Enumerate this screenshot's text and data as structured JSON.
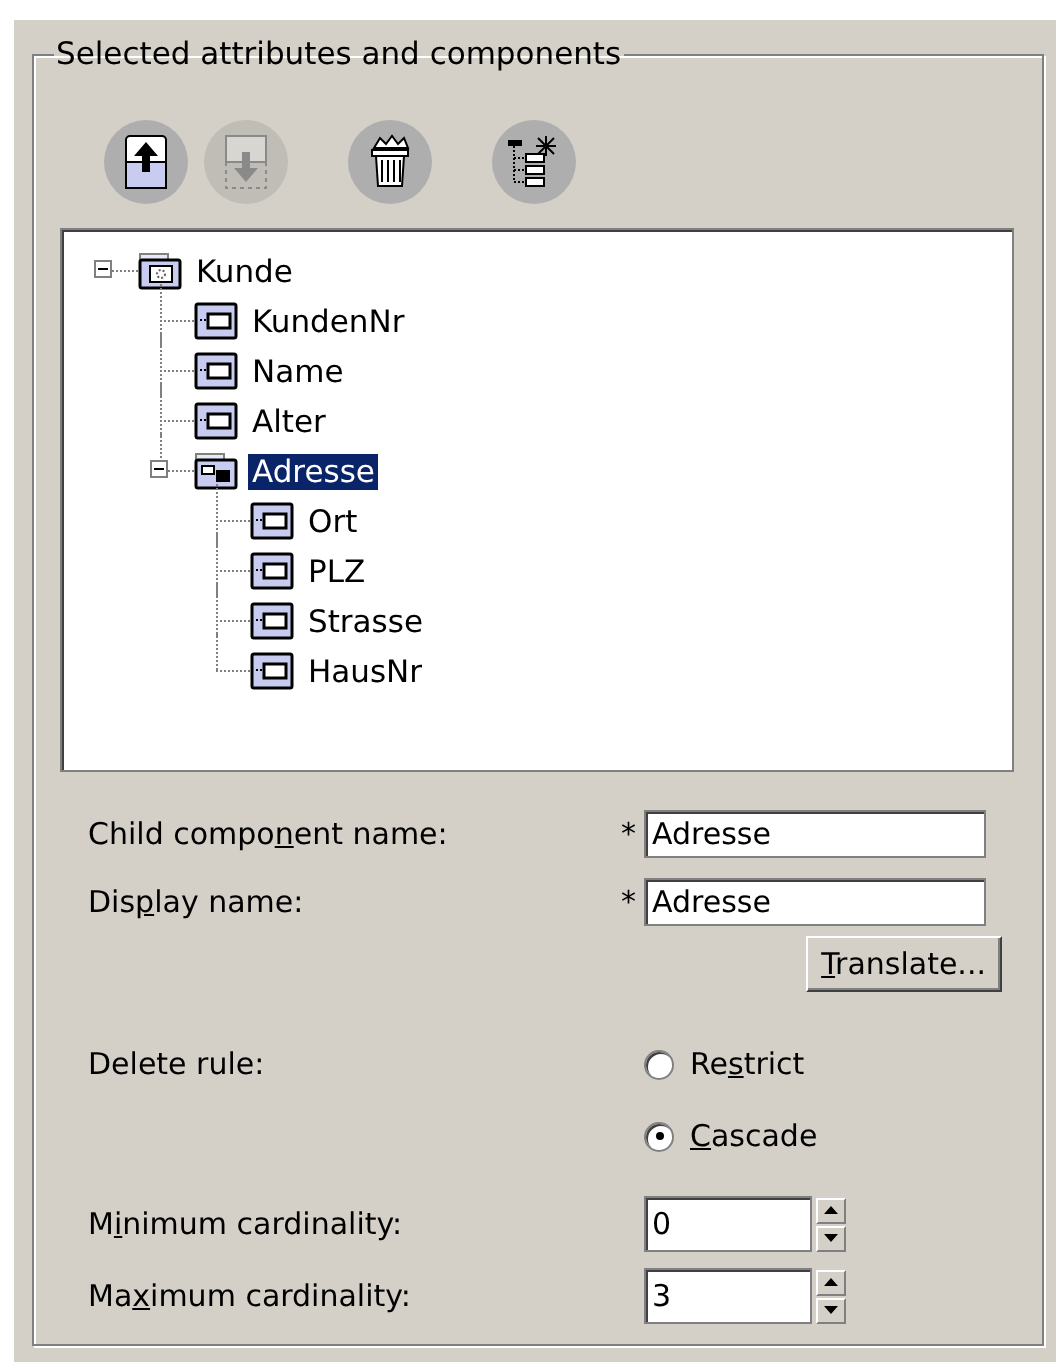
{
  "group": {
    "title": "Selected attributes and components"
  },
  "toolbar": [
    {
      "kind": "move-up",
      "disabled": false
    },
    {
      "kind": "move-down",
      "disabled": true
    },
    {
      "kind": "delete",
      "disabled": false
    },
    {
      "kind": "new-tree",
      "disabled": false
    }
  ],
  "tree": [
    {
      "label": "Kunde",
      "kind": "entity",
      "expanded": true,
      "selected": false,
      "children": [
        {
          "label": "KundenNr",
          "kind": "attribute",
          "selected": false
        },
        {
          "label": "Name",
          "kind": "attribute",
          "selected": false
        },
        {
          "label": "Alter",
          "kind": "attribute",
          "selected": false
        },
        {
          "label": "Adresse",
          "kind": "component",
          "expanded": true,
          "selected": true,
          "children": [
            {
              "label": "Ort",
              "kind": "attribute",
              "selected": false
            },
            {
              "label": "PLZ",
              "kind": "attribute",
              "selected": false
            },
            {
              "label": "Strasse",
              "kind": "attribute",
              "selected": false
            },
            {
              "label": "HausNr",
              "kind": "attribute",
              "selected": false
            }
          ]
        }
      ]
    }
  ],
  "fields": [
    {
      "label": {
        "pre": "Child compo",
        "key": "n",
        "post": "ent name:"
      },
      "required": "*",
      "value": "Adresse"
    },
    {
      "label": {
        "pre": "Dis",
        "key": "p",
        "post": "lay name:"
      },
      "required": "*",
      "value": "Adresse"
    }
  ],
  "translate_button": {
    "key": "T",
    "post": "ranslate..."
  },
  "delete_rule": {
    "label": "Delete rule:",
    "options": [
      {
        "pre": "Re",
        "key": "s",
        "post": "trict",
        "selected": false
      },
      {
        "key": "C",
        "post": "ascade",
        "selected": true
      }
    ]
  },
  "spinners": [
    {
      "label": {
        "pre": "M",
        "key": "i",
        "post": "nimum cardinality:"
      },
      "value": "0"
    },
    {
      "label": {
        "pre": "Ma",
        "key": "x",
        "post": "imum cardinality:"
      },
      "value": "3"
    }
  ]
}
